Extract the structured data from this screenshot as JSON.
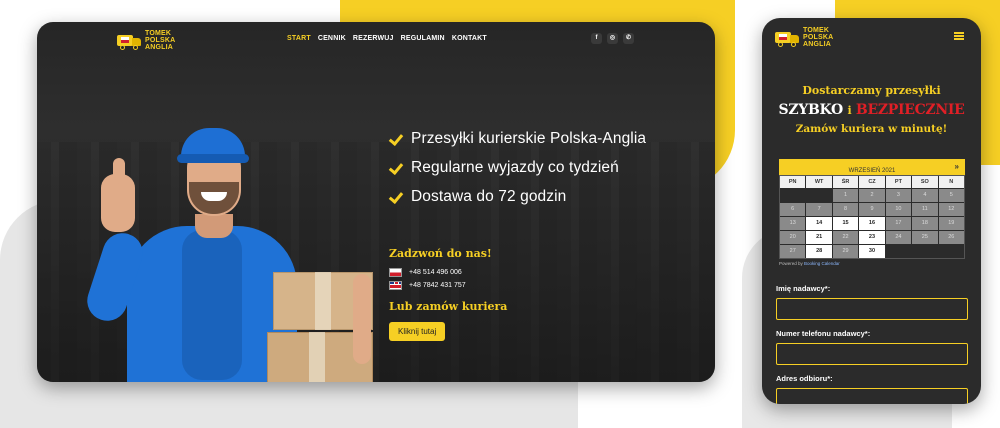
{
  "brand": {
    "logo_text": [
      "TOMEK",
      "POLSKA",
      "ANGLIA"
    ]
  },
  "colors": {
    "accent": "#f6cf24",
    "dark": "#2b2b2b",
    "danger": "#e01f26"
  },
  "desktop": {
    "nav": {
      "items": [
        {
          "label": "START",
          "active": true
        },
        {
          "label": "CENNIK",
          "active": false
        },
        {
          "label": "REZERWUJ",
          "active": false
        },
        {
          "label": "REGULAMIN",
          "active": false
        },
        {
          "label": "KONTAKT",
          "active": false
        }
      ]
    },
    "social": {
      "facebook": "f",
      "instagram": "◎",
      "whatsapp": "✆"
    },
    "benefits": [
      "Przesyłki kurierskie Polska-Anglia",
      "Regularne wyjazdy co tydzień",
      "Dostawa do 72 godzin"
    ],
    "call": {
      "title": "Zadzwoń do nas!",
      "phone_pl": "+48 514 496 006",
      "phone_uk": "+48 7842 431 757"
    },
    "order": {
      "title": "Lub zamów kuriera",
      "button": "Kliknij tutaj"
    }
  },
  "mobile": {
    "headline": {
      "line1": "Dostarczamy przesyłki",
      "fast": "SZYBKO",
      "and": "i",
      "safe": "BEZPIECZNIE",
      "line3": "Zamów kuriera w minutę!"
    },
    "calendar": {
      "month": "WRZESIEŃ 2021",
      "next": "»",
      "weekdays": [
        "PN",
        "WT",
        "ŚR",
        "CZ",
        "PT",
        "SO",
        "N"
      ],
      "powered_by": "Powered by",
      "powered_brand": "Booking Calendar",
      "weeks": [
        [
          "",
          "",
          "1",
          "2",
          "3",
          "4",
          "5"
        ],
        [
          "6",
          "7",
          "8",
          "9",
          "10",
          "11",
          "12"
        ],
        [
          "13",
          "14",
          "15",
          "16",
          "17",
          "18",
          "19"
        ],
        [
          "20",
          "21",
          "22",
          "23",
          "24",
          "25",
          "26"
        ],
        [
          "27",
          "28",
          "29",
          "30",
          "",
          "",
          ""
        ]
      ],
      "available": [
        "14",
        "15",
        "16",
        "21",
        "23",
        "28",
        "30"
      ]
    },
    "form": {
      "fields": [
        "Imię nadawcy*:",
        "Numer telefonu nadawcy*:",
        "Adres odbioru*:"
      ]
    }
  }
}
